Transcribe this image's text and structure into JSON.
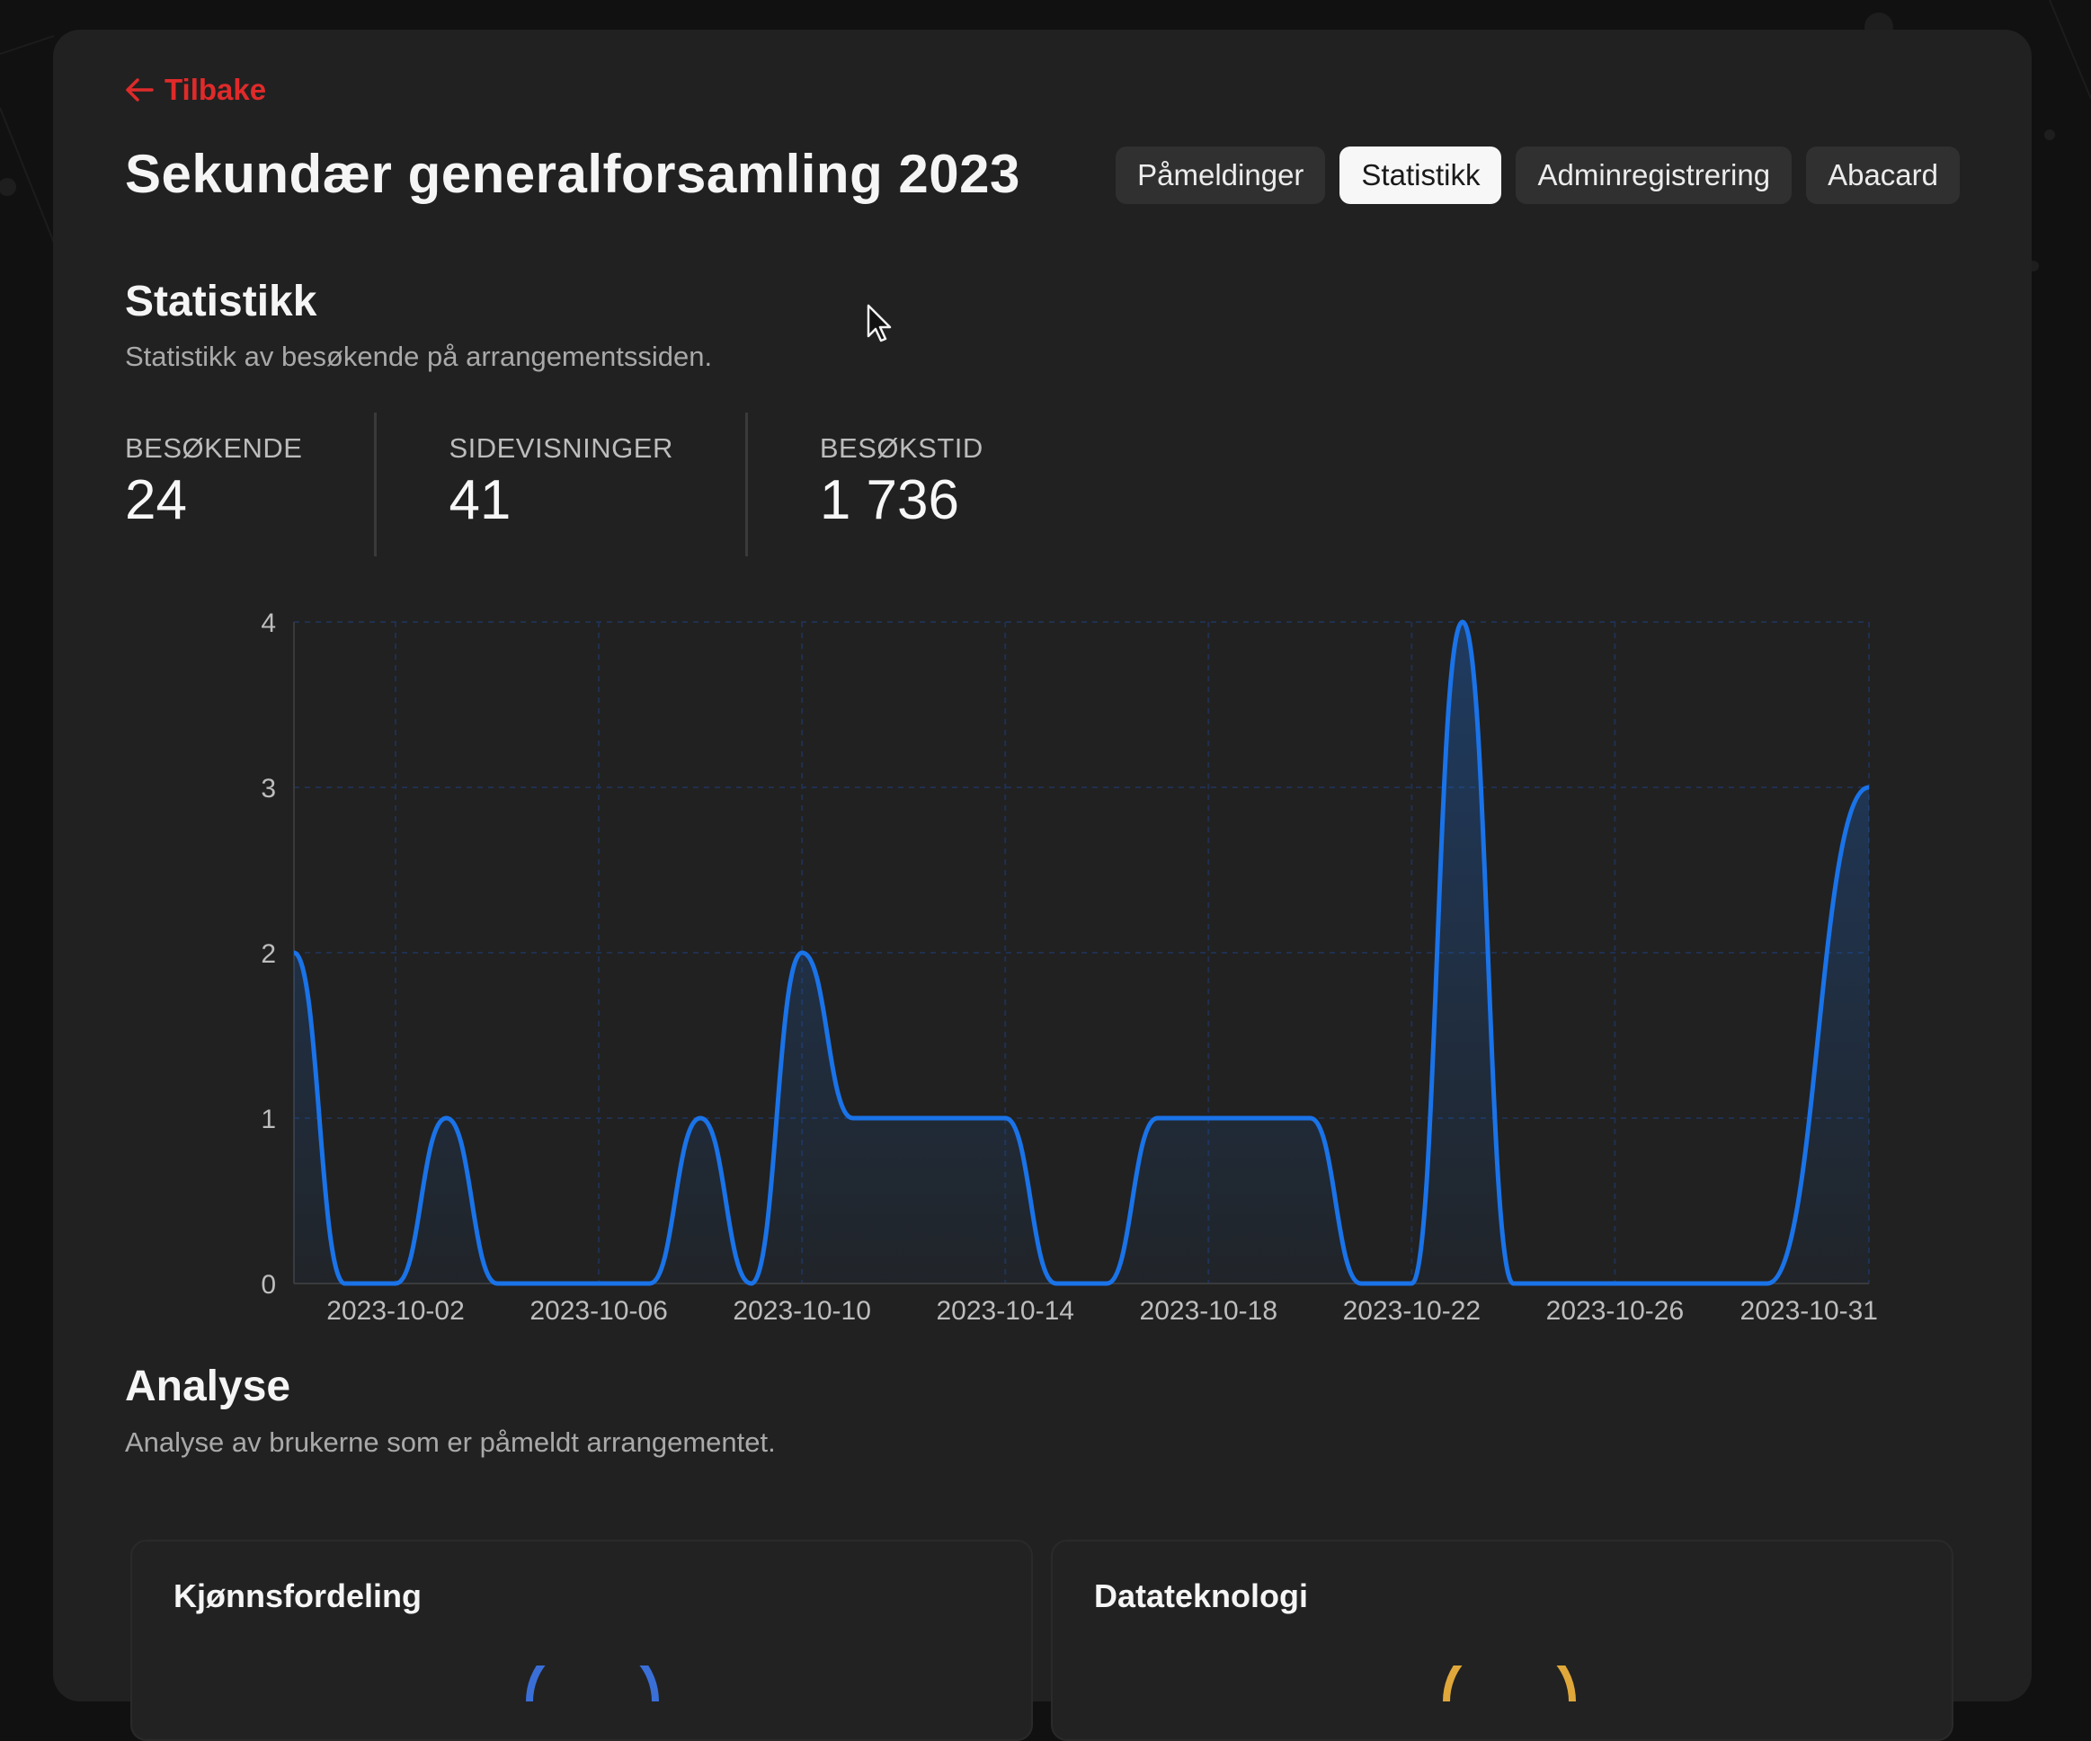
{
  "nav": {
    "back_label": "Tilbake"
  },
  "header": {
    "title": "Sekundær generalforsamling 2023",
    "tabs": [
      {
        "label": "Påmeldinger",
        "active": false
      },
      {
        "label": "Statistikk",
        "active": true
      },
      {
        "label": "Adminregistrering",
        "active": false
      },
      {
        "label": "Abacard",
        "active": false
      }
    ]
  },
  "statistics": {
    "title": "Statistikk",
    "subtitle": "Statistikk av besøkende på arrangementssiden.",
    "metrics": [
      {
        "label": "BESØKENDE",
        "value": "24"
      },
      {
        "label": "SIDEVISNINGER",
        "value": "41"
      },
      {
        "label": "BESØKSTID",
        "value": "1 736"
      }
    ]
  },
  "chart_data": {
    "type": "area",
    "x": [
      "2023-09-30",
      "2023-10-01",
      "2023-10-02",
      "2023-10-03",
      "2023-10-04",
      "2023-10-05",
      "2023-10-06",
      "2023-10-07",
      "2023-10-08",
      "2023-10-09",
      "2023-10-10",
      "2023-10-11",
      "2023-10-12",
      "2023-10-13",
      "2023-10-14",
      "2023-10-15",
      "2023-10-16",
      "2023-10-17",
      "2023-10-18",
      "2023-10-19",
      "2023-10-20",
      "2023-10-21",
      "2023-10-22",
      "2023-10-23",
      "2023-10-24",
      "2023-10-25",
      "2023-10-26",
      "2023-10-27",
      "2023-10-28",
      "2023-10-29",
      "2023-10-31"
    ],
    "series": [
      {
        "values": [
          2,
          0,
          0,
          1,
          0,
          0,
          0,
          0,
          1,
          0,
          2,
          1,
          1,
          1,
          1,
          0,
          0,
          1,
          1,
          1,
          1,
          0,
          0,
          4,
          0,
          0,
          0,
          0,
          0,
          0,
          3
        ]
      }
    ],
    "x_tick_labels": [
      "2023-10-02",
      "2023-10-06",
      "2023-10-10",
      "2023-10-14",
      "2023-10-18",
      "2023-10-22",
      "2023-10-26",
      "2023-10-31"
    ],
    "y_ticks": [
      0,
      1,
      2,
      3,
      4
    ],
    "ylim": [
      0,
      4
    ],
    "grid": true,
    "line_color": "#1a73e8",
    "fill_color": "#1a73e8",
    "grid_color": "#1f3050"
  },
  "analysis": {
    "title": "Analyse",
    "subtitle": "Analyse av brukerne som er påmeldt arrangementet.",
    "cards": [
      {
        "title": "Kjønnsfordeling"
      },
      {
        "title": "Datateknologi"
      }
    ]
  },
  "colors": {
    "accent_red": "#e02a2a",
    "panel_bg": "#212121",
    "page_bg": "#111111"
  }
}
